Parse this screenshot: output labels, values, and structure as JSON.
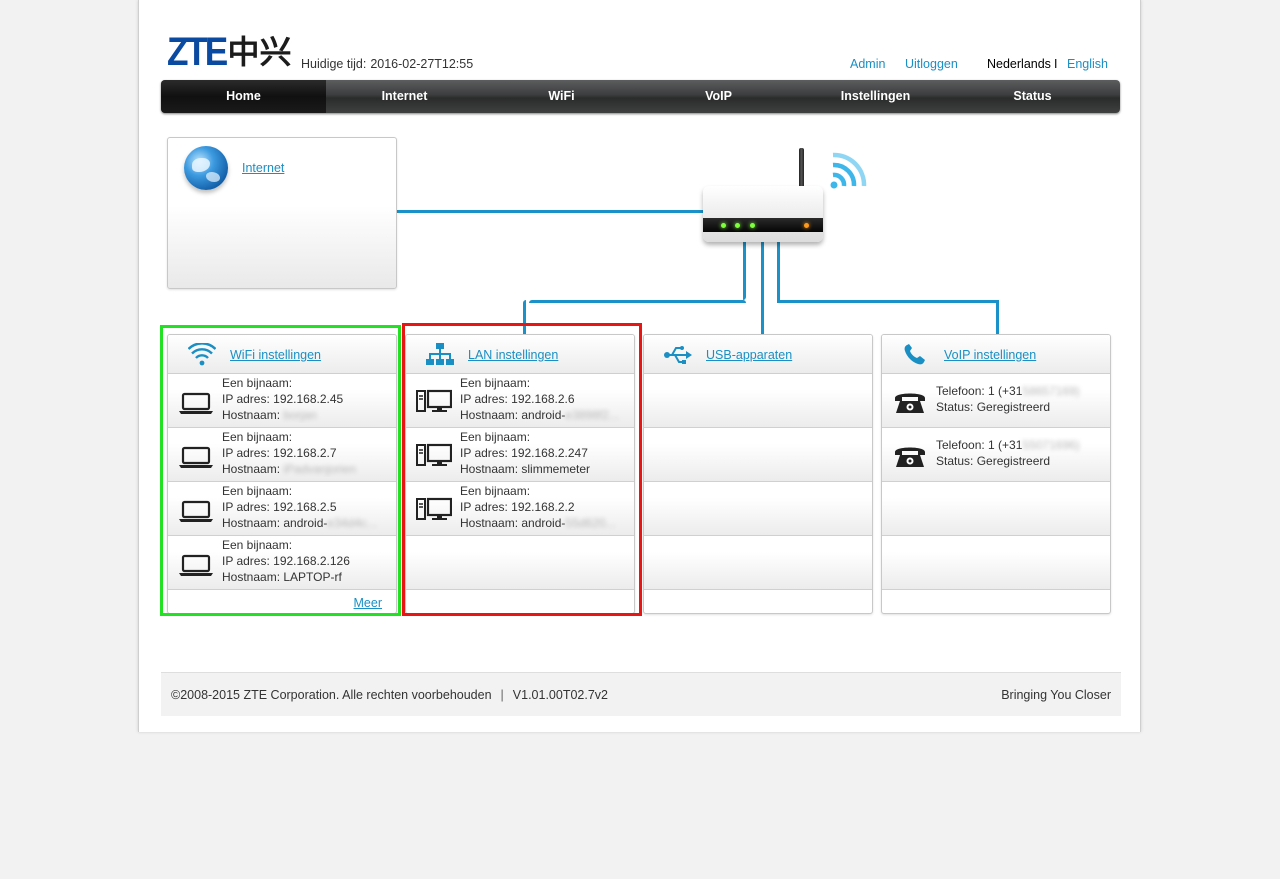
{
  "header": {
    "logo_latin": "ZTE",
    "logo_cn": "中兴",
    "time_label": "Huidige tijd:",
    "time_value": "2016-02-27T12:55",
    "admin": "Admin",
    "logout": "Uitloggen",
    "lang_nl": "Nederlands",
    "lang_sep": "I",
    "lang_en": "English"
  },
  "nav": {
    "tabs": [
      "Home",
      "Internet",
      "WiFi",
      "VoIP",
      "Instellingen",
      "Status"
    ],
    "active": "Home"
  },
  "internet": {
    "link": "Internet"
  },
  "wifi_panel": {
    "title": "WiFi instellingen",
    "more": "Meer",
    "devices": [
      {
        "name": "Een bijnaam:",
        "ip": "IP adres: 192.168.2.45",
        "host_label": "Hostnaam: ",
        "host_visible": "",
        "host_blur": "borjan"
      },
      {
        "name": "Een bijnaam:",
        "ip": "IP adres: 192.168.2.7",
        "host_label": "Hostnaam: ",
        "host_visible": "",
        "host_blur": "iPadvanjorien"
      },
      {
        "name": "Een bijnaam:",
        "ip": "IP adres: 192.168.2.5",
        "host_label": "Hostnaam: ",
        "host_visible": "android-",
        "host_blur": "e34d4c..."
      },
      {
        "name": "Een bijnaam:",
        "ip": "IP adres: 192.168.2.126",
        "host_label": "Hostnaam: ",
        "host_visible": "LAPTOP-rf",
        "host_blur": ""
      }
    ]
  },
  "lan_panel": {
    "title": "LAN instellingen",
    "devices": [
      {
        "name": "Een bijnaam:",
        "ip": "IP adres: 192.168.2.6",
        "host_label": "Hostnaam: ",
        "host_visible": "android-",
        "host_blur": "e3898f2..."
      },
      {
        "name": "Een bijnaam:",
        "ip": "IP adres: 192.168.2.247",
        "host_label": "Hostnaam: ",
        "host_visible": "slimmemeter",
        "host_blur": ""
      },
      {
        "name": "Een bijnaam:",
        "ip": "IP adres: 192.168.2.2",
        "host_label": "Hostnaam: ",
        "host_visible": "android-",
        "host_blur": "55d620..."
      }
    ]
  },
  "usb_panel": {
    "title": "USB-apparaten"
  },
  "voip_panel": {
    "title": "VoIP instellingen",
    "lines": [
      {
        "phone_visible": "Telefoon: 1 (+31",
        "phone_blur": "58657169)",
        "status": "Status: Geregistreerd"
      },
      {
        "phone_visible": "Telefoon: 1 (+31",
        "phone_blur": "55071696)",
        "status": "Status: Geregistreerd"
      }
    ]
  },
  "footer": {
    "copyright": "©2008-2015 ZTE Corporation. Alle rechten voorbehouden",
    "sep": "|",
    "version": "V1.01.00T02.7v2",
    "slogan": "Bringing You Closer"
  },
  "colors": {
    "link": "#1a8fc4",
    "wire": "#1a91c8",
    "highlight_wifi": "#22e022",
    "highlight_lan": "#e81515",
    "logo": "#0b4aa1"
  }
}
